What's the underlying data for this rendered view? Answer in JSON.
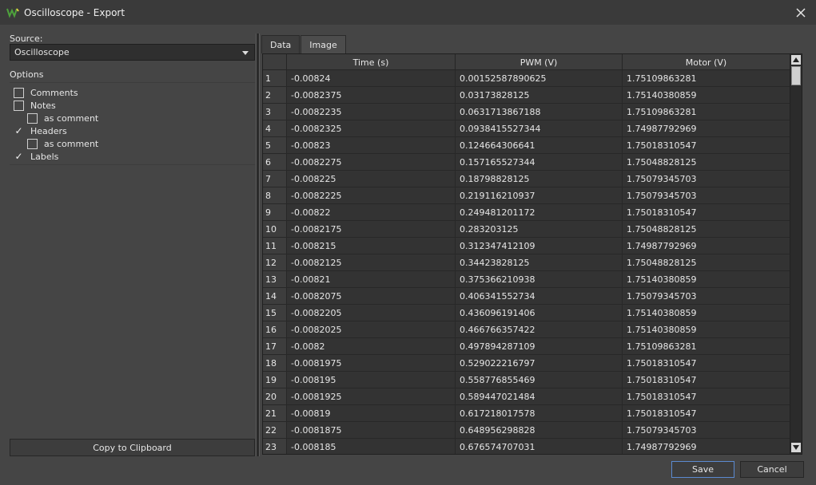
{
  "window": {
    "title": "Oscilloscope - Export",
    "icon": "oscilloscope-wave-icon",
    "accent_color": "#4ea23c"
  },
  "source": {
    "label": "Source:",
    "selected": "Oscilloscope"
  },
  "options": {
    "label": "Options",
    "items": [
      {
        "label": "Comments",
        "checked": false,
        "indent": 0
      },
      {
        "label": "Notes",
        "checked": false,
        "indent": 0
      },
      {
        "label": "as comment",
        "checked": false,
        "indent": 1
      },
      {
        "label": "Headers",
        "checked": true,
        "indent": 0
      },
      {
        "label": "as comment",
        "checked": false,
        "indent": 1
      },
      {
        "label": "Labels",
        "checked": true,
        "indent": 0
      }
    ]
  },
  "copy_label": "Copy to Clipboard",
  "tabs": [
    {
      "label": "Data",
      "active": true
    },
    {
      "label": "Image",
      "active": false
    }
  ],
  "table": {
    "columns": [
      "Time (s)",
      "PWM (V)",
      "Motor (V)"
    ],
    "rows": [
      [
        "1",
        "-0.00824",
        "0.00152587890625",
        "1.75109863281"
      ],
      [
        "2",
        "-0.0082375",
        "0.03173828125",
        "1.75140380859"
      ],
      [
        "3",
        "-0.0082235",
        "0.0631713867188",
        "1.75109863281"
      ],
      [
        "4",
        "-0.0082325",
        "0.0938415527344",
        "1.74987792969"
      ],
      [
        "5",
        "-0.00823",
        "0.124664306641",
        "1.75018310547"
      ],
      [
        "6",
        "-0.0082275",
        "0.157165527344",
        "1.75048828125"
      ],
      [
        "7",
        "-0.008225",
        "0.18798828125",
        "1.75079345703"
      ],
      [
        "8",
        "-0.0082225",
        "0.219116210937",
        "1.75079345703"
      ],
      [
        "9",
        "-0.00822",
        "0.249481201172",
        "1.75018310547"
      ],
      [
        "10",
        "-0.0082175",
        "0.283203125",
        "1.75048828125"
      ],
      [
        "11",
        "-0.008215",
        "0.312347412109",
        "1.74987792969"
      ],
      [
        "12",
        "-0.0082125",
        "0.34423828125",
        "1.75048828125"
      ],
      [
        "13",
        "-0.00821",
        "0.375366210938",
        "1.75140380859"
      ],
      [
        "14",
        "-0.0082075",
        "0.406341552734",
        "1.75079345703"
      ],
      [
        "15",
        "-0.0082205",
        "0.436096191406",
        "1.75140380859"
      ],
      [
        "16",
        "-0.0082025",
        "0.466766357422",
        "1.75140380859"
      ],
      [
        "17",
        "-0.0082",
        "0.497894287109",
        "1.75109863281"
      ],
      [
        "18",
        "-0.0081975",
        "0.529022216797",
        "1.75018310547"
      ],
      [
        "19",
        "-0.008195",
        "0.558776855469",
        "1.75018310547"
      ],
      [
        "20",
        "-0.0081925",
        "0.589447021484",
        "1.75018310547"
      ],
      [
        "21",
        "-0.00819",
        "0.617218017578",
        "1.75018310547"
      ],
      [
        "22",
        "-0.0081875",
        "0.648956298828",
        "1.75079345703"
      ],
      [
        "23",
        "-0.008185",
        "0.676574707031",
        "1.74987792969"
      ]
    ]
  },
  "buttons": {
    "save": "Save",
    "cancel": "Cancel"
  }
}
